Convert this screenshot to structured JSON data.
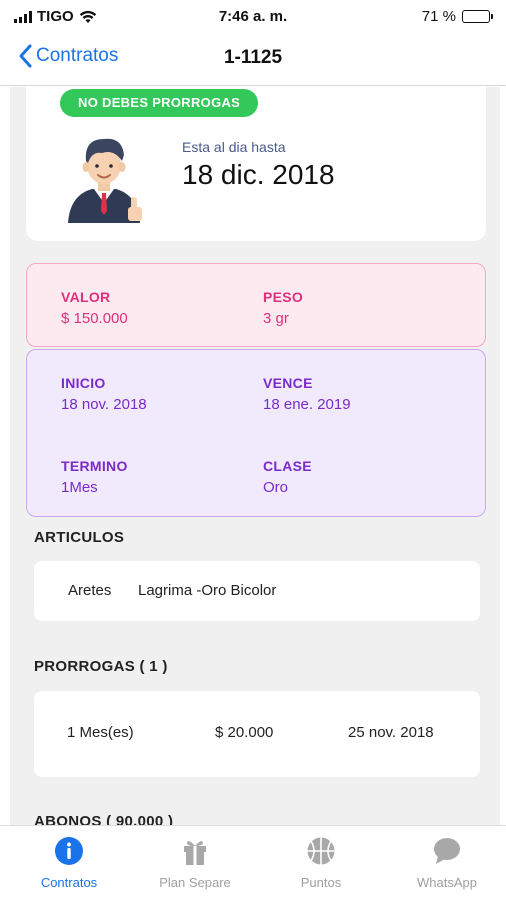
{
  "status_bar": {
    "carrier": "TIGO",
    "time": "7:46 a. m.",
    "battery": "71 %"
  },
  "nav": {
    "back_label": "Contratos",
    "title": "1-1125"
  },
  "summary": {
    "badge": "NO DEBES PRORROGAS",
    "up_to_label": "Esta al dia hasta",
    "up_to_date": "18 dic. 2018"
  },
  "value_box": {
    "valor_label": "VALOR",
    "valor": "$ 150.000",
    "peso_label": "PESO",
    "peso": "3 gr"
  },
  "dates_box": {
    "inicio_label": "INICIO",
    "inicio": "18 nov. 2018",
    "vence_label": "VENCE",
    "vence": "18 ene. 2019",
    "termino_label": "TERMINO",
    "termino": "1Mes",
    "clase_label": "CLASE",
    "clase": "Oro"
  },
  "articulos": {
    "title": "ARTICULOS",
    "items": [
      {
        "name": "Aretes",
        "description": "Lagrima -Oro Bicolor"
      }
    ]
  },
  "prorrogas": {
    "title": "PRORROGAS ( 1 )",
    "items": [
      {
        "period": "1 Mes(es)",
        "amount": "$ 20.000",
        "date": "25 nov. 2018"
      }
    ]
  },
  "abonos": {
    "title": "ABONOS ( 90.000 )"
  },
  "tabs": [
    {
      "label": "Contratos",
      "icon": "info-icon",
      "active": true
    },
    {
      "label": "Plan Separe",
      "icon": "gift-icon",
      "active": false
    },
    {
      "label": "Puntos",
      "icon": "basketball-icon",
      "active": false
    },
    {
      "label": "WhatsApp",
      "icon": "chat-bubble-icon",
      "active": false
    }
  ],
  "colors": {
    "accent": "#1a73e8",
    "badge_green": "#34c759",
    "pink_text": "#e0307c",
    "purple_text": "#7a2bc8"
  }
}
